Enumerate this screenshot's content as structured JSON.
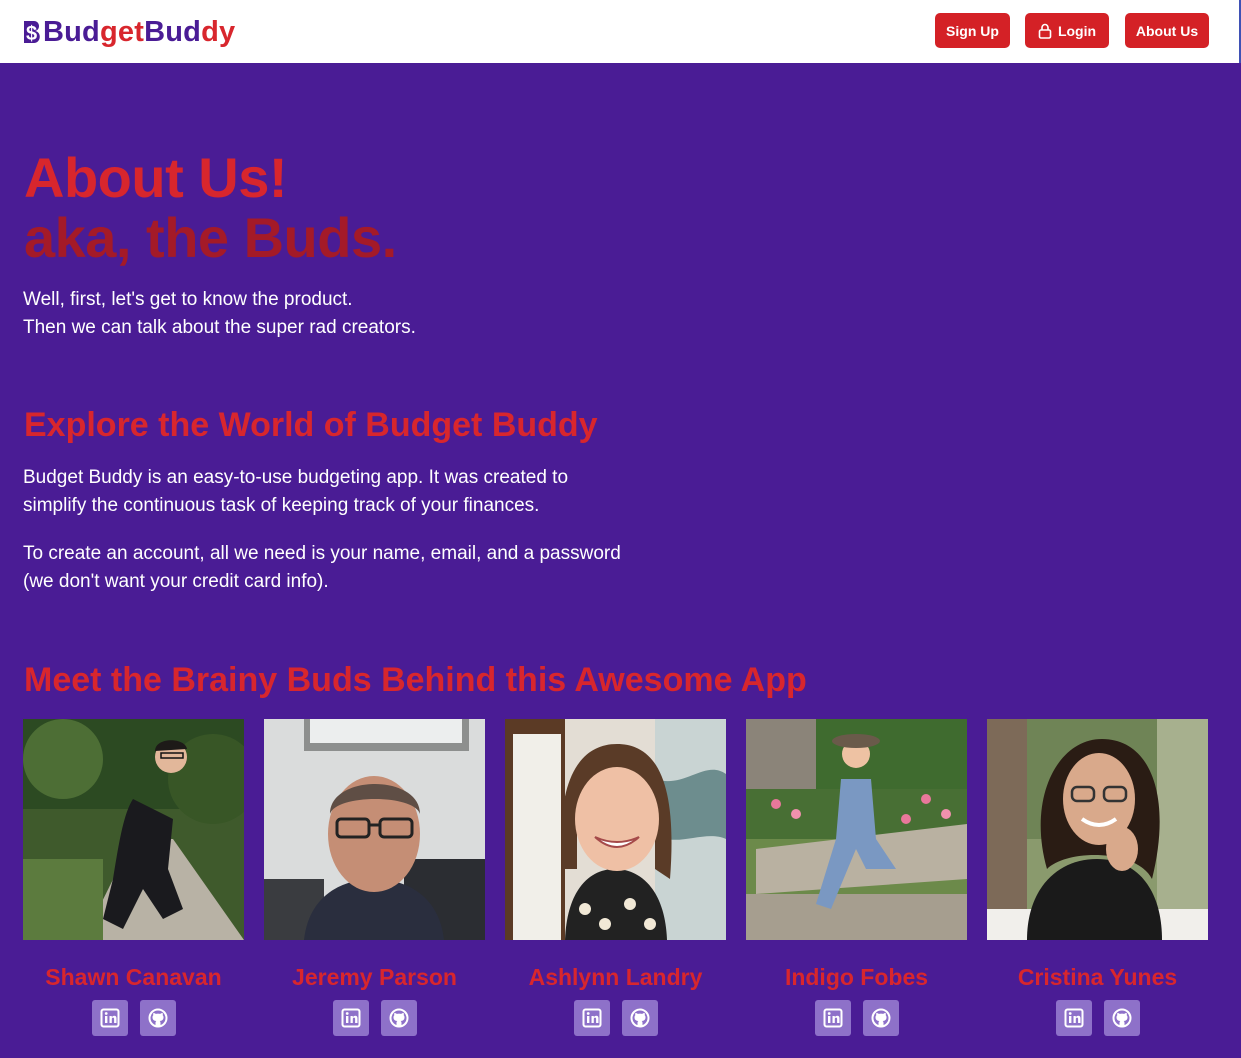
{
  "brand": {
    "logo_mark": "$",
    "name_part1": "Bud",
    "name_part2": "get ",
    "name_part3": "Bud",
    "name_part4": "dy"
  },
  "nav": {
    "signup_label": "Sign Up",
    "login_label": "Login",
    "about_label": "About Us"
  },
  "hero": {
    "title": "About Us!",
    "subtitle": "aka, the Buds.",
    "intro_line1": "Well, first, let's get to know the product.",
    "intro_line2": "Then we can talk about the super rad creators."
  },
  "explore": {
    "heading": "Explore the World of Budget Buddy",
    "paragraph1": "Budget Buddy is an easy-to-use budgeting app. It was created to simplify the continuous task of keeping track of your finances.",
    "paragraph2": "To create an account, all we need is your name, email, and a password (we don't want your credit card info)."
  },
  "team": {
    "heading": "Meet the Brainy Buds Behind this Awesome App",
    "members": [
      {
        "name": "Shawn Canavan"
      },
      {
        "name": "Jeremy Parson"
      },
      {
        "name": "Ashlynn Landry"
      },
      {
        "name": "Indigo Fobes"
      },
      {
        "name": "Cristina Yunes"
      }
    ]
  },
  "icons": {
    "linkedin": "linkedin-icon",
    "github": "github-icon",
    "lock": "lock-icon"
  },
  "colors": {
    "background": "#4a1c95",
    "accent_red": "#d8262d",
    "dark_red": "#a41a28",
    "button_red": "#d42126",
    "social_bg": "#8e71c9",
    "navbar": "#ffffff"
  }
}
